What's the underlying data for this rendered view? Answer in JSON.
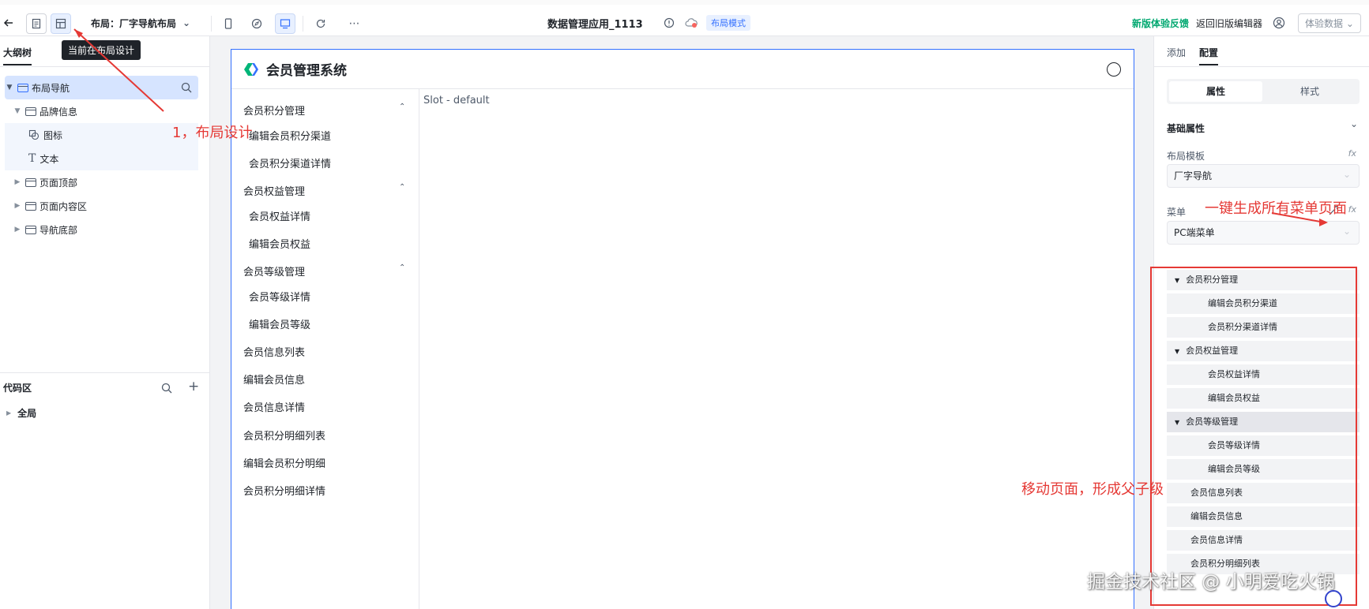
{
  "topbar": {
    "back_icon": "arrow-left-icon",
    "layout_select": "布局：厂字导航布局",
    "app_title": "数据管理应用_1113",
    "mode_badge": "布局模式",
    "feedback": "新版体验反馈",
    "old_editor": "返回旧版编辑器",
    "trial": "体验数据",
    "tooltip": "当前在布局设计"
  },
  "left": {
    "tab": "大纲树",
    "tree": [
      {
        "label": "布局导航",
        "level": 0,
        "selected": true
      },
      {
        "label": "品牌信息",
        "level": 1
      },
      {
        "label": "图标",
        "level": 2
      },
      {
        "label": "文本",
        "level": 2
      },
      {
        "label": "页面顶部",
        "level": 1
      },
      {
        "label": "页面内容区",
        "level": 1
      },
      {
        "label": "导航底部",
        "level": 1
      }
    ],
    "code_title": "代码区",
    "code_global": "全局"
  },
  "canvas": {
    "brand": "会员管理系统",
    "slot": "Slot - default",
    "nav": [
      {
        "label": "会员积分管理",
        "group": true
      },
      {
        "label": "编辑会员积分渠道"
      },
      {
        "label": "会员积分渠道详情"
      },
      {
        "label": "会员权益管理",
        "group": true
      },
      {
        "label": "会员权益详情"
      },
      {
        "label": "编辑会员权益"
      },
      {
        "label": "会员等级管理",
        "group": true
      },
      {
        "label": "会员等级详情"
      },
      {
        "label": "编辑会员等级"
      },
      {
        "label": "会员信息列表",
        "top": true
      },
      {
        "label": "编辑会员信息",
        "top": true
      },
      {
        "label": "会员信息详情",
        "top": true
      },
      {
        "label": "会员积分明细列表",
        "top": true
      },
      {
        "label": "编辑会员积分明细",
        "top": true
      },
      {
        "label": "会员积分明细详情",
        "top": true
      }
    ]
  },
  "right": {
    "tab_add": "添加",
    "tab_config": "配置",
    "seg_props": "属性",
    "seg_style": "样式",
    "section": "基础属性",
    "layout_template_label": "布局模板",
    "layout_template_value": "厂字导航",
    "menu_label": "菜单",
    "menu_value": "PC端菜单",
    "fx": "fx",
    "menu_rows": [
      {
        "label": "会员积分管理",
        "group": true
      },
      {
        "label": "编辑会员积分渠道"
      },
      {
        "label": "会员积分渠道详情"
      },
      {
        "label": "会员权益管理",
        "group": true
      },
      {
        "label": "会员权益详情"
      },
      {
        "label": "编辑会员权益"
      },
      {
        "label": "会员等级管理",
        "group": true
      },
      {
        "label": "会员等级详情"
      },
      {
        "label": "编辑会员等级"
      },
      {
        "label": "会员信息列表",
        "top": true
      },
      {
        "label": "编辑会员信息",
        "top": true
      },
      {
        "label": "会员信息详情",
        "top": true
      },
      {
        "label": "会员积分明细列表",
        "top": true
      }
    ]
  },
  "annotations": {
    "step1": "1，布局设计",
    "generate": "一键生成所有菜单页面",
    "move": "移动页面，形成父子级",
    "color": "#e53935"
  },
  "watermark": "掘金技术社区 @ 小明爱吃火锅"
}
